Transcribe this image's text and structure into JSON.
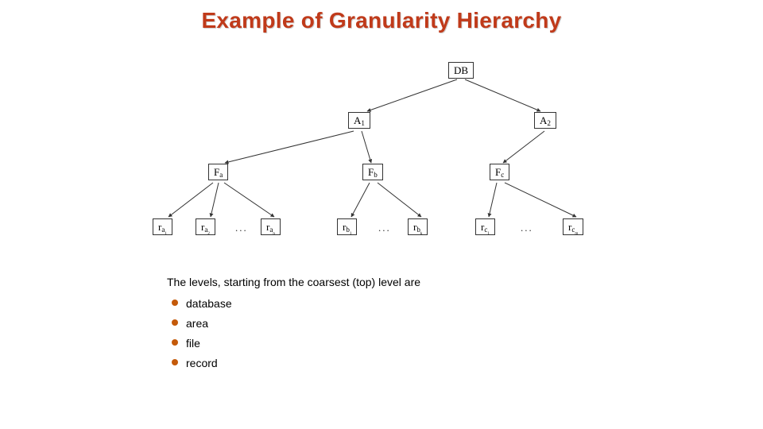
{
  "title": "Example of Granularity Hierarchy",
  "tree": {
    "root": "DB",
    "level2": {
      "A1": "A",
      "A2": "A"
    },
    "level3": {
      "Fa": "F",
      "Fb": "F",
      "Fc": "F"
    },
    "level4": {
      "ra1": "r",
      "ra2": "r",
      "ran": "r",
      "rb1": "r",
      "rbk": "r",
      "rc1": "r",
      "rcm": "r"
    }
  },
  "caption": "The levels, starting from the coarsest (top) level are",
  "bullets": [
    "database",
    "area",
    "file",
    "record"
  ]
}
